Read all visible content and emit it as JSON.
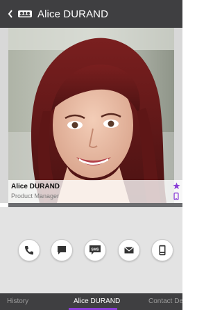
{
  "header": {
    "title": "Alice DURAND",
    "back_icon": "chevron-left-icon",
    "app_icon": "contacts-icon"
  },
  "contact": {
    "name": "Alice DURAND",
    "role": "Product Manager",
    "favorite_icon": "star-icon",
    "device_icon": "mobile-phone-icon",
    "accent": "#8a3dd6"
  },
  "actions": [
    {
      "icon": "phone-call-icon"
    },
    {
      "icon": "chat-message-icon"
    },
    {
      "icon": "sms-icon",
      "label": "SMS"
    },
    {
      "icon": "email-icon"
    },
    {
      "icon": "mobile-device-icon"
    }
  ],
  "tabs": {
    "left": "History",
    "center": "Alice DURAND",
    "right": "Contact De"
  }
}
